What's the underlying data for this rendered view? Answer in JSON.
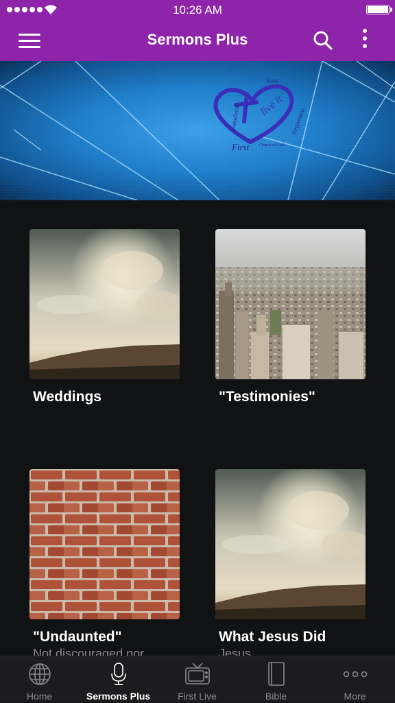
{
  "status": {
    "time": "10:26 AM"
  },
  "header": {
    "title": "Sermons Plus",
    "menu_icon": "hamburger-menu-icon",
    "search_icon": "search-icon",
    "more_icon": "vertical-dots-icon",
    "bar_color": "#8e24aa"
  },
  "banner": {
    "logo_words": [
      "love",
      "live it",
      "forgiveness",
      "acceptance"
    ],
    "logo_brand": "First",
    "logo_tag": "Church of God"
  },
  "cards": [
    {
      "title": "Weddings",
      "subtitle": "",
      "image": "sky-clouds-desert"
    },
    {
      "title": "\"Testimonies\"",
      "subtitle": "",
      "image": "city-skyline"
    },
    {
      "title": "\"Undaunted\"",
      "subtitle": "Not discouraged nor",
      "image": "brick-wall"
    },
    {
      "title": "What Jesus Did",
      "subtitle": "Jesus",
      "image": "sky-clouds-desert"
    }
  ],
  "tabs": [
    {
      "label": "Home",
      "icon": "globe-icon",
      "active": false
    },
    {
      "label": "Sermons Plus",
      "icon": "microphone-icon",
      "active": true
    },
    {
      "label": "First Live",
      "icon": "tv-icon",
      "active": false
    },
    {
      "label": "Bible",
      "icon": "book-icon",
      "active": false
    },
    {
      "label": "More",
      "icon": "more-dots-icon",
      "active": false
    }
  ]
}
